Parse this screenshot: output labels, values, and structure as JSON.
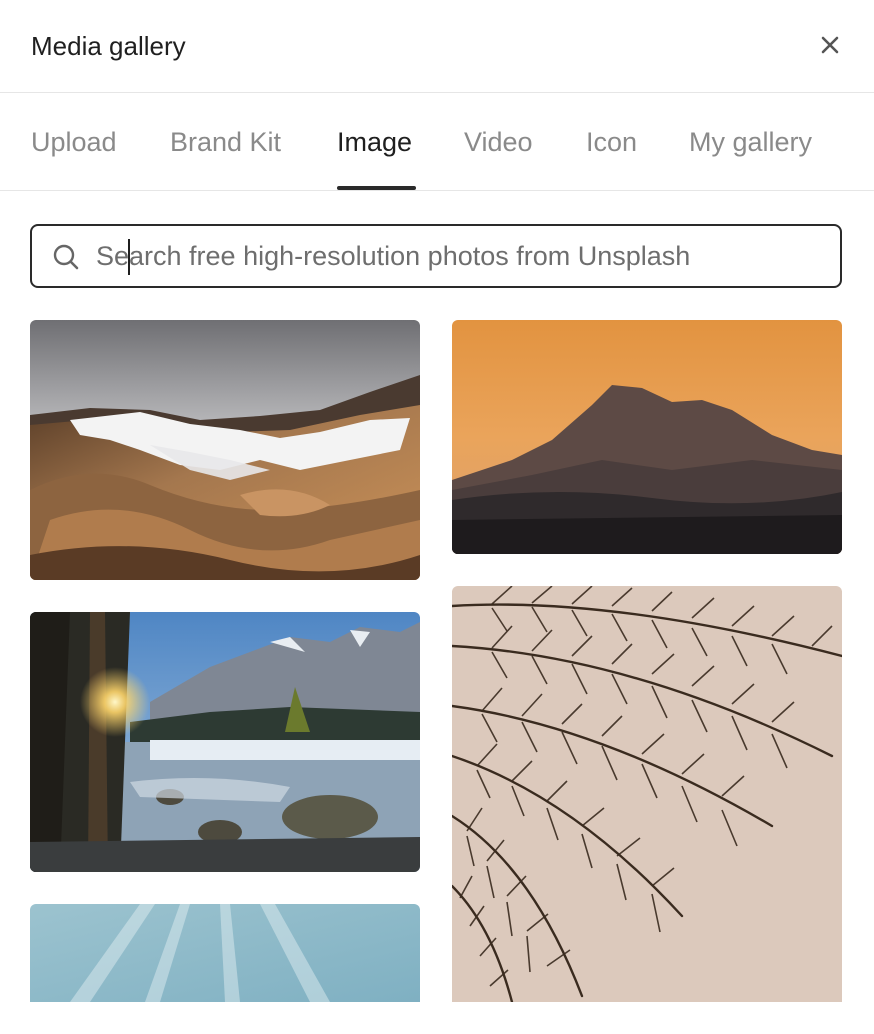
{
  "header": {
    "title": "Media gallery",
    "close_icon": "close-icon"
  },
  "tabs": [
    {
      "label": "Upload",
      "active": false
    },
    {
      "label": "Brand Kit",
      "active": false
    },
    {
      "label": "Image",
      "active": true
    },
    {
      "label": "Video",
      "active": false
    },
    {
      "label": "Icon",
      "active": false
    },
    {
      "label": "My gallery",
      "active": false
    }
  ],
  "search": {
    "placeholder": "Search free high-resolution photos from Unsplash",
    "value": "",
    "icon": "search-icon"
  },
  "gallery": {
    "images": [
      {
        "subject": "snowy volcanic mountains"
      },
      {
        "subject": "mountain silhouette at sunset"
      },
      {
        "subject": "alpine lake with sunburst"
      },
      {
        "subject": "palm fronds silhouette"
      },
      {
        "subject": "sky with light rays"
      }
    ]
  },
  "colors": {
    "accent": "#2a2a2a",
    "inactive_tab": "#8a8a8a",
    "border": "#e6e6e6"
  }
}
